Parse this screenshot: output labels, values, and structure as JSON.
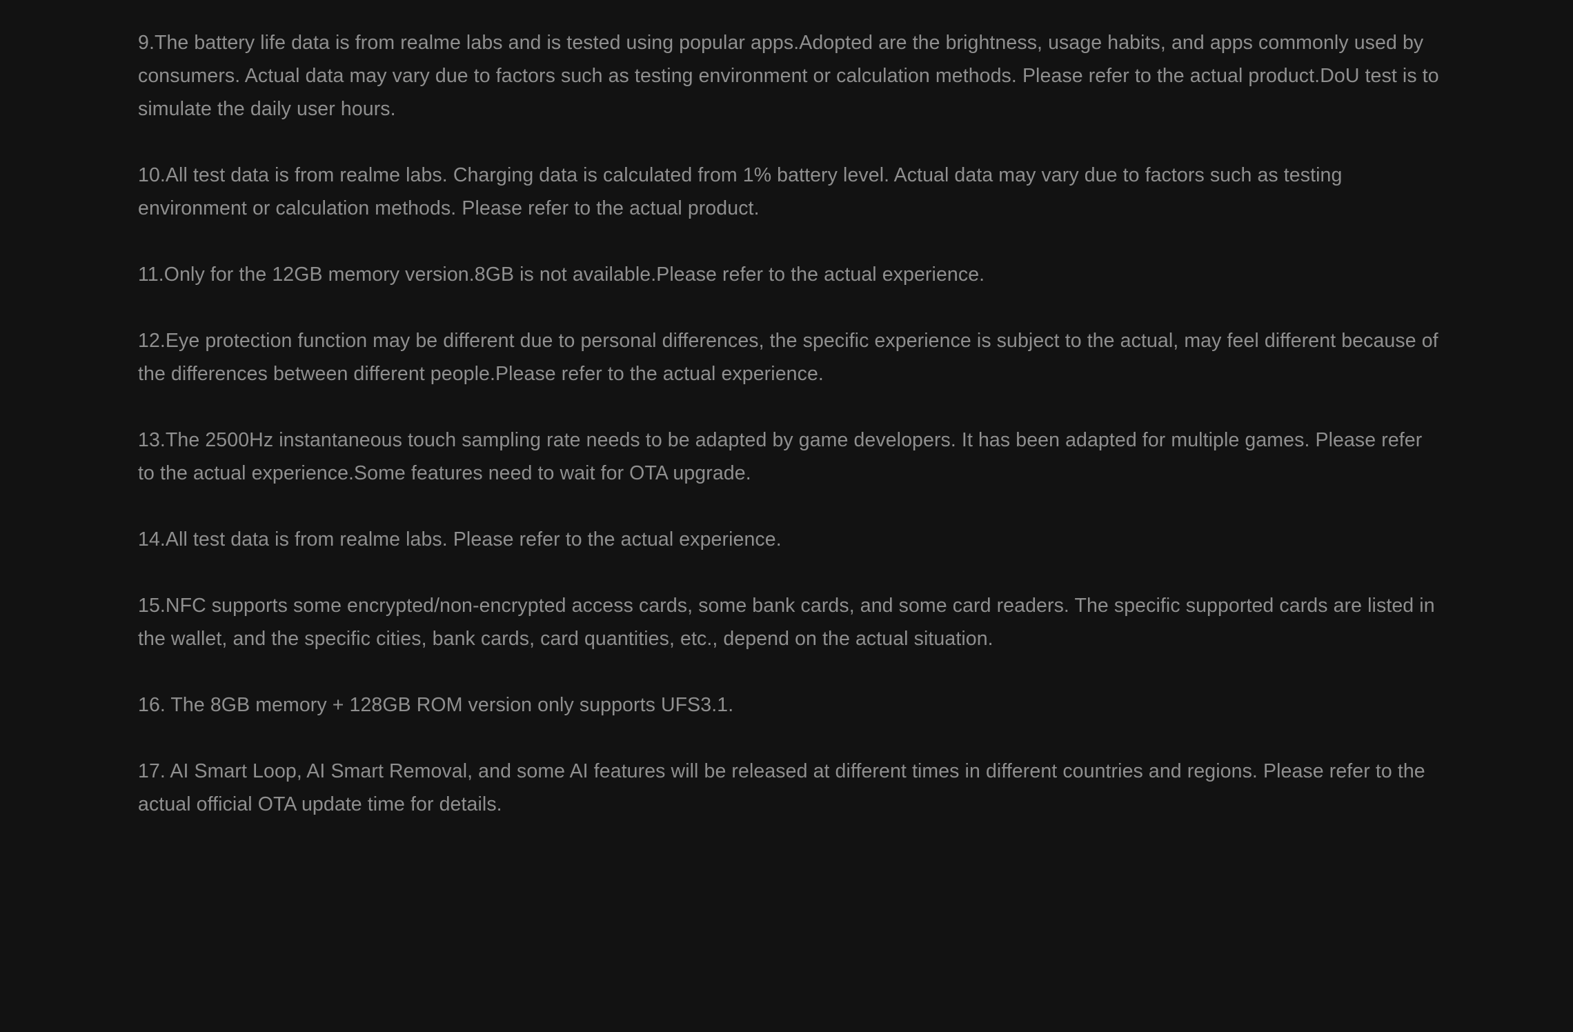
{
  "disclaimer": {
    "notes": [
      "9.The battery life data is from realme labs and is tested using popular apps.Adopted are the brightness, usage habits, and apps commonly used by consumers. Actual data may vary due to factors such as testing environment or calculation methods. Please refer to the actual product.DoU test is to simulate the daily user hours.",
      "10.All test data is from realme labs. Charging data is calculated from 1% battery level. Actual data may vary due to factors such as testing environment or calculation methods. Please refer to the actual product.",
      "11.Only for the 12GB memory version.8GB is not available.Please refer to the actual experience.",
      "12.Eye protection function may be different due to personal differences, the specific experience is subject to the actual, may feel different because of the differences between different people.Please refer to the actual experience.",
      "13.The 2500Hz instantaneous touch sampling rate needs to be adapted by game developers. It has been adapted for multiple games. Please refer to the actual experience.Some features need to wait for OTA upgrade.",
      "14.All test data is from realme labs. Please refer to the actual experience.",
      "15.NFC supports some encrypted/non-encrypted access cards, some bank cards, and some card readers. The specific supported cards are listed in the wallet, and the specific cities, bank cards, card quantities, etc., depend on the actual situation.",
      "16. The 8GB memory + 128GB ROM version only supports UFS3.1.",
      "17. AI Smart Loop, AI Smart Removal, and some AI features will be released at different times in different countries and regions. Please refer to the actual official OTA update time for details."
    ]
  },
  "colors": {
    "background": "#121212",
    "text": "#8f8f8f"
  }
}
